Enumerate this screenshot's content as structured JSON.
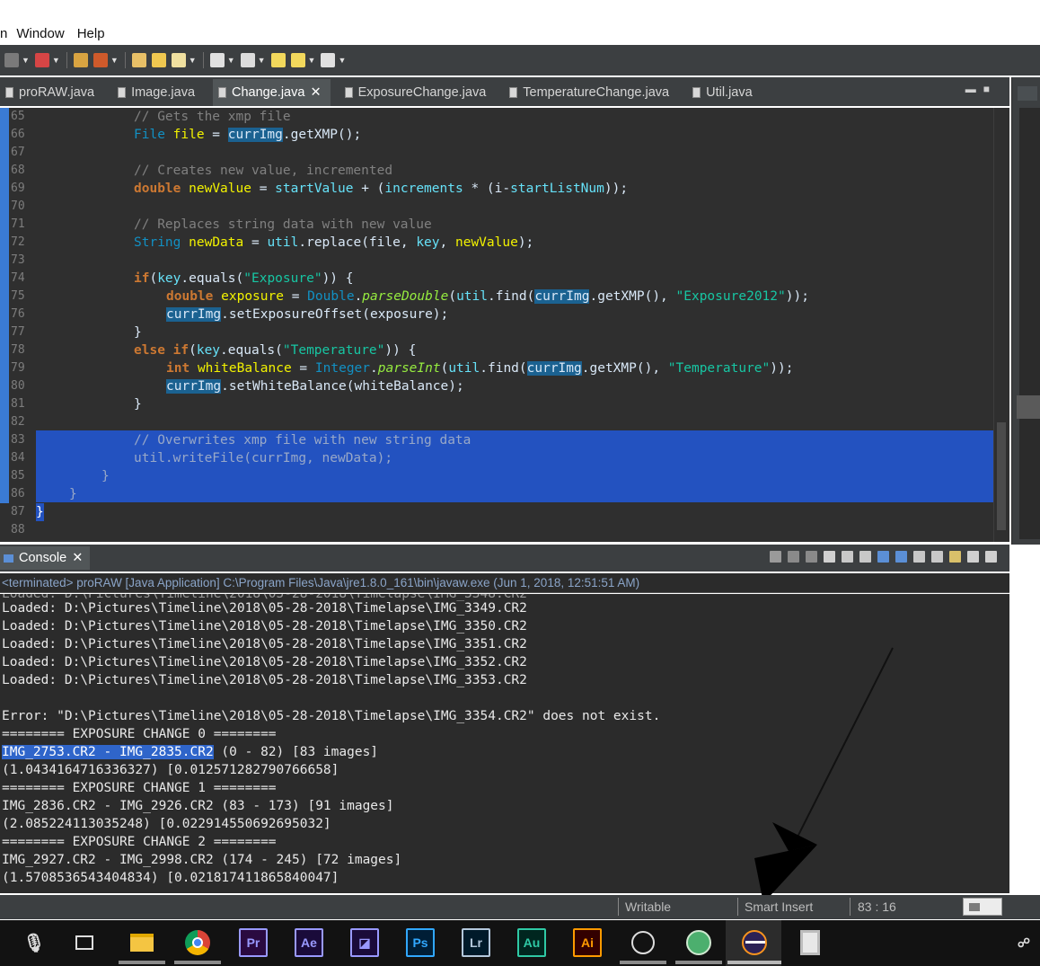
{
  "menu": {
    "fragment": "n",
    "items": [
      "Window",
      "Help"
    ]
  },
  "tabs": [
    {
      "label": "proRAW.java",
      "active": false
    },
    {
      "label": "Image.java",
      "active": false
    },
    {
      "label": "Change.java",
      "active": true
    },
    {
      "label": "ExposureChange.java",
      "active": false
    },
    {
      "label": "TemperatureChange.java",
      "active": false
    },
    {
      "label": "Util.java",
      "active": false
    }
  ],
  "tab_close": "✕",
  "line_numbers": [
    "65",
    "66",
    "67",
    "68",
    "69",
    "70",
    "71",
    "72",
    "73",
    "74",
    "75",
    "76",
    "77",
    "78",
    "79",
    "80",
    "81",
    "82",
    "83",
    "84",
    "85",
    "86",
    "87",
    "88"
  ],
  "code": {
    "l65": "// Gets the xmp file",
    "l66_type": "File",
    "l66_var": "file",
    "l66_eq": " = ",
    "l66_obj": "currImg",
    "l66_call": ".getXMP();",
    "l68": "// Creates new value, incremented",
    "l69_type": "double",
    "l69_var": "newValue",
    "l69_rest1": " = ",
    "l69_f1": "startValue",
    "l69_rest2": " + (",
    "l69_f2": "increments",
    "l69_rest3": " * (i-",
    "l69_f3": "startListNum",
    "l69_rest4": "));",
    "l71": "// Replaces string data with new value",
    "l72_type": "String",
    "l72_var": "newData",
    "l72_rest1": " = ",
    "l72_f1": "util",
    "l72_rest2": ".replace(file, ",
    "l72_f2": "key",
    "l72_rest3": ", ",
    "l72_f3": "newValue",
    "l72_rest4": ");",
    "l74_kw": "if",
    "l74_rest1": "(",
    "l74_f1": "key",
    "l74_rest2": ".equals(",
    "l74_str": "\"Exposure\"",
    "l74_rest3": ")) {",
    "l75_kw": "double",
    "l75_var": "exposure",
    "l75_rest1": " = ",
    "l75_cls": "Double",
    "l75_rest2": ".",
    "l75_m": "parseDouble",
    "l75_rest3": "(",
    "l75_f1": "util",
    "l75_rest4": ".find(",
    "l75_obj": "currImg",
    "l75_rest5": ".getXMP(), ",
    "l75_str": "\"Exposure2012\"",
    "l75_rest6": "));",
    "l76_obj": "currImg",
    "l76_rest": ".setExposureOffset(exposure);",
    "l77": "}",
    "l78_kw": "else if",
    "l78_rest1": "(",
    "l78_f1": "key",
    "l78_rest2": ".equals(",
    "l78_str": "\"Temperature\"",
    "l78_rest3": ")) {",
    "l79_kw": "int",
    "l79_var": "whiteBalance",
    "l79_rest1": " = ",
    "l79_cls": "Integer",
    "l79_rest2": ".",
    "l79_m": "parseInt",
    "l79_rest3": "(",
    "l79_f1": "util",
    "l79_rest4": ".find(",
    "l79_obj": "currImg",
    "l79_rest5": ".getXMP(), ",
    "l79_str": "\"Temperature\"",
    "l79_rest6": "));",
    "l80_obj": "currImg",
    "l80_rest": ".setWhiteBalance(whiteBalance);",
    "l81": "}",
    "l83": "// Overwrites xmp file with new string data",
    "l84": "util.writeFile(currImg, newData);",
    "l85": "}",
    "l86": "}",
    "l87": "}"
  },
  "console": {
    "title": "Console",
    "status": "<terminated> proRAW [Java Application] C:\\Program Files\\Java\\jre1.8.0_161\\bin\\javaw.exe (Jun 1, 2018, 12:51:51 AM)",
    "lines": [
      "Loaded: D:\\Pictures\\Timeline\\2018\\05-28-2018\\Timelapse\\IMG_3349.CR2",
      "Loaded: D:\\Pictures\\Timeline\\2018\\05-28-2018\\Timelapse\\IMG_3350.CR2",
      "Loaded: D:\\Pictures\\Timeline\\2018\\05-28-2018\\Timelapse\\IMG_3351.CR2",
      "Loaded: D:\\Pictures\\Timeline\\2018\\05-28-2018\\Timelapse\\IMG_3352.CR2",
      "Loaded: D:\\Pictures\\Timeline\\2018\\05-28-2018\\Timelapse\\IMG_3353.CR2",
      "",
      "Error: \"D:\\Pictures\\Timeline\\2018\\05-28-2018\\Timelapse\\IMG_3354.CR2\" does not exist.",
      "======== EXPOSURE CHANGE 0 ========"
    ],
    "sel_text": "IMG_2753.CR2 - IMG_2835.CR2",
    "sel_rest": " (0 - 82) [83 images]",
    "lines2": [
      "(1.0434164716336327) [0.012571282790766658]",
      "======== EXPOSURE CHANGE 1 ========",
      "IMG_2836.CR2 - IMG_2926.CR2 (83 - 173) [91 images]",
      "(2.085224113035248) [0.022914550692695032]",
      "======== EXPOSURE CHANGE 2 ========",
      "IMG_2927.CR2 - IMG_2998.CR2 (174 - 245) [72 images]",
      "(1.5708536543404834) [0.021817411865840047]"
    ]
  },
  "statusbar": {
    "writable": "Writable",
    "insert_mode": "Smart Insert",
    "position": "83 : 16"
  },
  "taskbar": {
    "apps": [
      {
        "name": "premiere-pro",
        "label": "Pr",
        "color": "#9999ff"
      },
      {
        "name": "after-effects",
        "label": "Ae",
        "color": "#9999ff"
      },
      {
        "name": "photoshop",
        "label": "Ps",
        "color": "#31a8ff"
      },
      {
        "name": "lightroom",
        "label": "Lr",
        "color": "#b4c8dc"
      },
      {
        "name": "audition",
        "label": "Au",
        "color": "#2fc9a5"
      },
      {
        "name": "illustrator",
        "label": "Ai",
        "color": "#ff9a00"
      }
    ]
  },
  "colors": {
    "accent": "#2352c0",
    "ide_bg": "#2f2f2f",
    "panel_bg": "#3c3f41"
  }
}
